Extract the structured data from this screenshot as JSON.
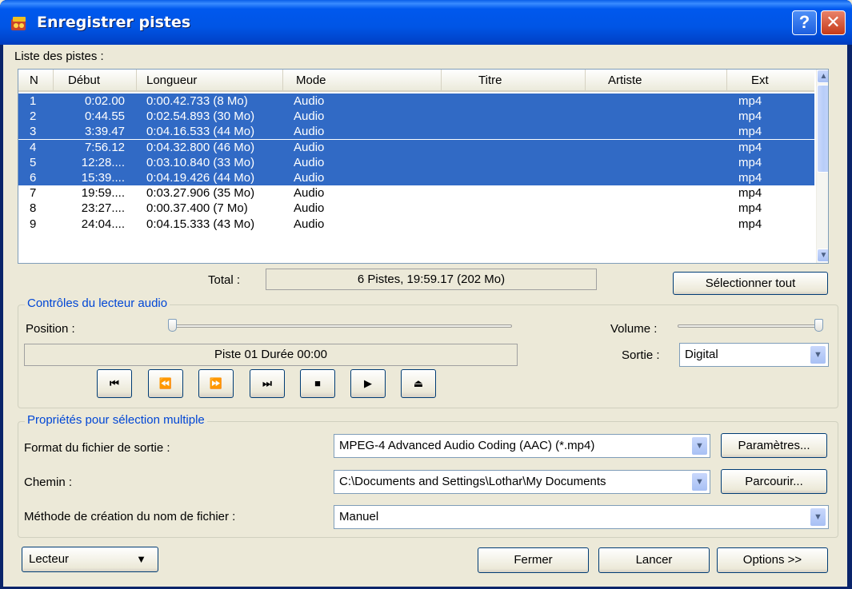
{
  "window": {
    "title": "Enregistrer pistes",
    "help_glyph": "?",
    "close_glyph": "✕"
  },
  "tracklist": {
    "label": "Liste des pistes :",
    "columns": [
      "N",
      "Début",
      "Longueur",
      "Mode",
      "Titre",
      "Artiste",
      "Ext"
    ],
    "rows": [
      {
        "n": "1",
        "debut": "0:02.00",
        "longueur": "0:00.42.733 (8 Mo)",
        "mode": "Audio",
        "titre": "",
        "artiste": "",
        "ext": "mp4",
        "selected": true
      },
      {
        "n": "2",
        "debut": "0:44.55",
        "longueur": "0:02.54.893 (30 Mo)",
        "mode": "Audio",
        "titre": "",
        "artiste": "",
        "ext": "mp4",
        "selected": true
      },
      {
        "n": "3",
        "debut": "3:39.47",
        "longueur": "0:04.16.533 (44 Mo)",
        "mode": "Audio",
        "titre": "",
        "artiste": "",
        "ext": "mp4",
        "selected": true
      },
      {
        "n": "4",
        "debut": "7:56.12",
        "longueur": "0:04.32.800 (46 Mo)",
        "mode": "Audio",
        "titre": "",
        "artiste": "",
        "ext": "mp4",
        "selected": true
      },
      {
        "n": "5",
        "debut": "12:28....",
        "longueur": "0:03.10.840 (33 Mo)",
        "mode": "Audio",
        "titre": "",
        "artiste": "",
        "ext": "mp4",
        "selected": true
      },
      {
        "n": "6",
        "debut": "15:39....",
        "longueur": "0:04.19.426 (44 Mo)",
        "mode": "Audio",
        "titre": "",
        "artiste": "",
        "ext": "mp4",
        "selected": true
      },
      {
        "n": "7",
        "debut": "19:59....",
        "longueur": "0:03.27.906 (35 Mo)",
        "mode": "Audio",
        "titre": "",
        "artiste": "",
        "ext": "mp4",
        "selected": false
      },
      {
        "n": "8",
        "debut": "23:27....",
        "longueur": "0:00.37.400 (7 Mo)",
        "mode": "Audio",
        "titre": "",
        "artiste": "",
        "ext": "mp4",
        "selected": false
      },
      {
        "n": "9",
        "debut": "24:04....",
        "longueur": "0:04.15.333 (43 Mo)",
        "mode": "Audio",
        "titre": "",
        "artiste": "",
        "ext": "mp4",
        "selected": false
      }
    ],
    "total_label": "Total :",
    "total_value": "6 Pistes,   19:59.17 (202 Mo)",
    "select_all_button": "Sélectionner tout"
  },
  "player": {
    "group_title": "Contrôles du lecteur audio",
    "position_label": "Position :",
    "volume_label": "Volume :",
    "status_text": "Piste 01 Durée 00:00",
    "output_label": "Sortie :",
    "output_value": "Digital",
    "position_value": 0,
    "volume_value": 1,
    "buttons": [
      {
        "name": "go-start-button",
        "glyph": "⏮"
      },
      {
        "name": "rewind-button",
        "glyph": "⏪"
      },
      {
        "name": "fast-forward-button",
        "glyph": "⏩"
      },
      {
        "name": "go-end-button",
        "glyph": "⏭"
      },
      {
        "name": "stop-button",
        "glyph": "■"
      },
      {
        "name": "play-button",
        "glyph": "▶"
      },
      {
        "name": "eject-button",
        "glyph": "⏏"
      }
    ]
  },
  "properties": {
    "group_title": "Propriétés pour sélection multiple",
    "format_label": "Format du fichier de sortie :",
    "format_value": "MPEG-4 Advanced Audio Coding (AAC) (*.mp4)",
    "settings_button": "Paramètres...",
    "path_label": "Chemin :",
    "path_value": "C:\\Documents and Settings\\Lothar\\My Documents",
    "browse_button": "Parcourir...",
    "naming_label": "Méthode de création du nom de fichier :",
    "naming_value": "Manuel"
  },
  "footer": {
    "player_menu": "Lecteur",
    "close_button": "Fermer",
    "start_button": "Lancer",
    "options_button": "Options >>"
  },
  "colors": {
    "selection": "#316ac5",
    "titlebar": "#0058ee",
    "group_title": "#0046d5"
  }
}
